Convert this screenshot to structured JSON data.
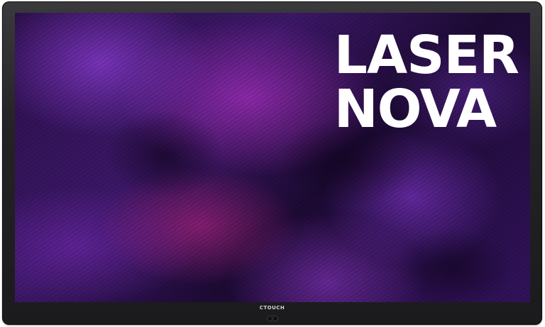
{
  "display": {
    "brand_logo": "CTOUCH",
    "screen": {
      "headline_line1": "LASER",
      "headline_line2": "NOVA",
      "headline_color": "#ffffff",
      "wallpaper_palette": [
        "#2a0f4a",
        "#3b1766",
        "#8c3cd2",
        "#c8288c"
      ]
    }
  }
}
